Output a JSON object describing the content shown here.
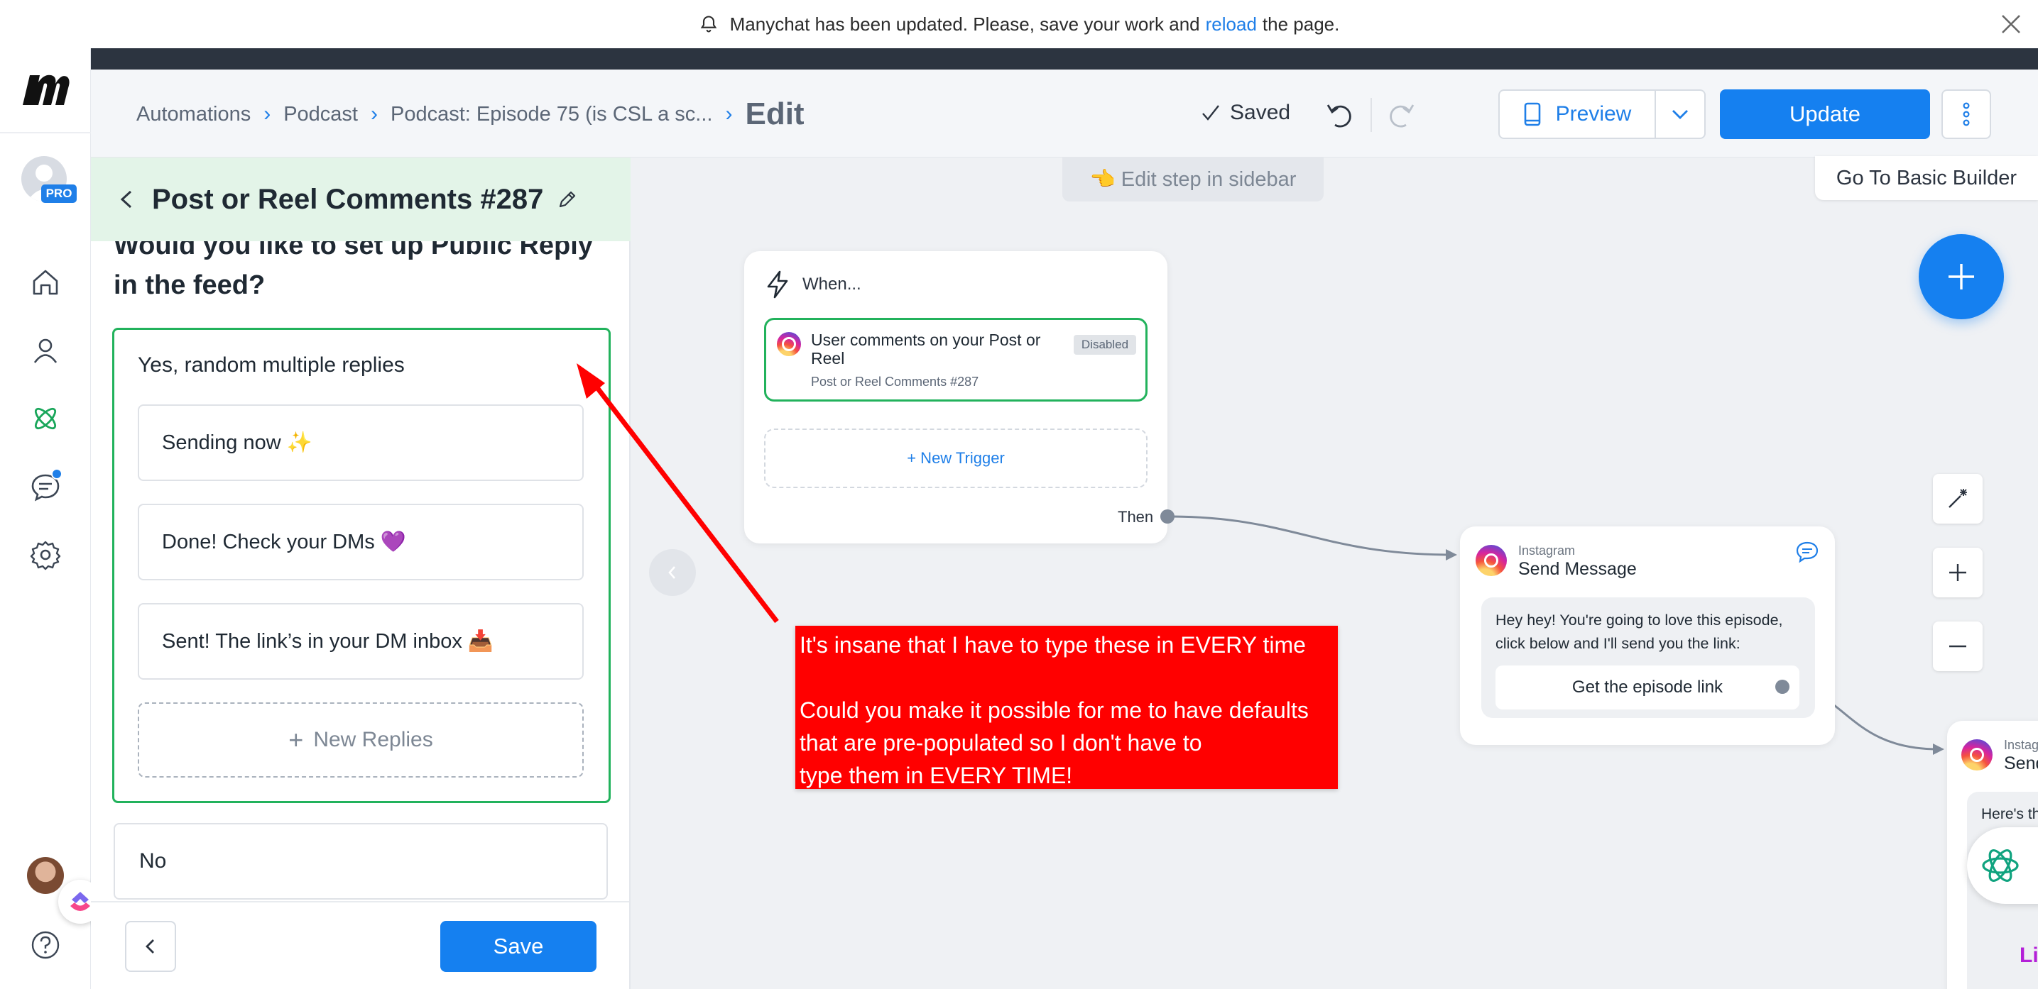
{
  "banner": {
    "text_before": "Manychat has been updated. Please, save your work and",
    "link": "reload",
    "text_after": "the page."
  },
  "rail": {
    "pro_badge": "PRO"
  },
  "breadcrumb": {
    "items": [
      "Automations",
      "Podcast",
      "Podcast: Episode 75 (is CSL a sc..."
    ],
    "current": "Edit"
  },
  "toolbar": {
    "saved": "Saved",
    "preview": "Preview",
    "update": "Update"
  },
  "panel": {
    "title": "Post or Reel Comments #287",
    "question": "Would you like to set up Public Reply in the feed?",
    "option_yes": "Yes, random multiple replies",
    "replies": [
      "Sending now ✨",
      "Done! Check your DMs 💜",
      "Sent! The link’s in your DM inbox 📥"
    ],
    "new_replies": "New Replies",
    "option_no": "No",
    "save": "Save"
  },
  "canvas": {
    "edit_hint": "👈 Edit step in sidebar",
    "basic_builder": "Go To Basic Builder",
    "trigger_card": {
      "when": "When...",
      "trigger_title": "User comments on your Post or Reel",
      "trigger_sub": "Post or Reel Comments #287",
      "badge": "Disabled",
      "new_trigger": "+ New Trigger",
      "then": "Then"
    },
    "message_card": {
      "channel": "Instagram",
      "title": "Send Message",
      "text": "Hey hey! You're going to love this episode, click below and I'll send you the link:",
      "button": "Get the episode link"
    },
    "message_card_2": {
      "channel": "Instagr",
      "title": "Send",
      "text": "Here's th",
      "footer": "Li"
    }
  },
  "annotation": {
    "line1": "It's insane that I have to type these in EVERY time",
    "line2": "Could you make it possible for me to have defaults",
    "line3": "that are pre-populated so I don't have to",
    "line4": "type them in EVERY TIME!"
  },
  "colors": {
    "accent": "#1580f0",
    "success": "#22b25c",
    "annotation": "#ff0000",
    "panel_header": "#e3f4e8"
  },
  "icons": [
    "bell-icon",
    "close-icon",
    "manychat-logo",
    "home-icon",
    "contacts-icon",
    "automation-icon",
    "chat-icon",
    "settings-icon",
    "help-icon",
    "undo-icon",
    "redo-icon",
    "phone-icon",
    "chevron-down-icon",
    "kebab-icon",
    "pencil-icon",
    "plus-icon",
    "lightning-icon",
    "instagram-icon",
    "comment-icon",
    "magic-wand-icon",
    "zoom-in-icon",
    "zoom-out-icon",
    "chatgpt-icon",
    "clickup-icon"
  ]
}
